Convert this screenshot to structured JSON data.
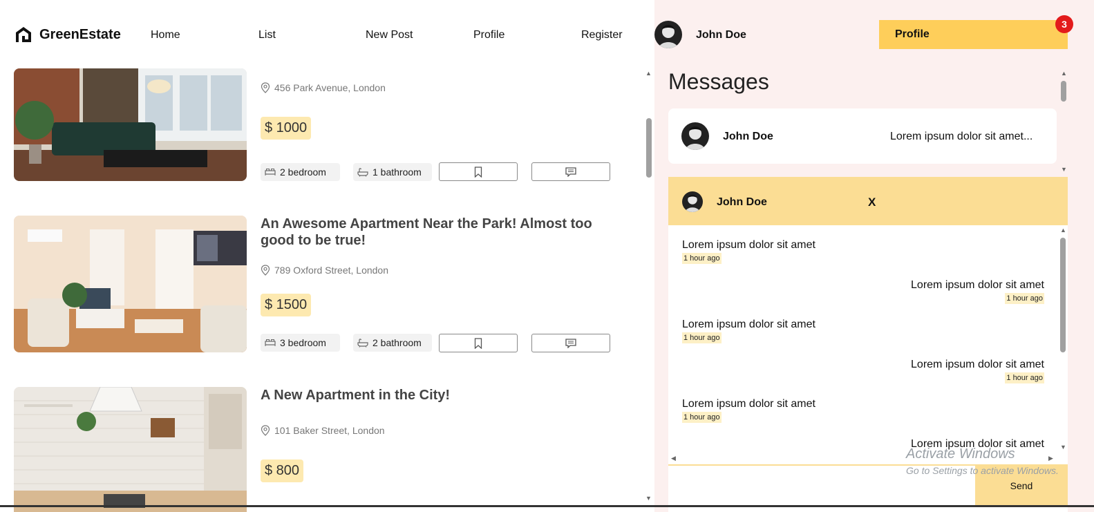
{
  "brand": {
    "name": "GreenEstate"
  },
  "nav": {
    "links": [
      "Home",
      "List",
      "New Post",
      "Profile",
      "Register"
    ]
  },
  "user": {
    "name": "John Doe",
    "profile_label": "Profile",
    "notification_count": "3"
  },
  "listings": [
    {
      "title": "",
      "address": "456 Park Avenue, London",
      "price": "$ 1000",
      "bedrooms": "2 bedroom",
      "bathrooms": "1 bathroom"
    },
    {
      "title": "An Awesome Apartment Near the Park! Almost too good to be true!",
      "address": "789 Oxford Street, London",
      "price": "$ 1500",
      "bedrooms": "3 bedroom",
      "bathrooms": "2 bathroom"
    },
    {
      "title": "A New Apartment in the City!",
      "address": "101 Baker Street, London",
      "price": "$ 800"
    }
  ],
  "messages": {
    "title": "Messages",
    "conversations": [
      {
        "name": "John Doe",
        "preview": "Lorem ipsum dolor sit amet..."
      }
    ],
    "chat": {
      "name": "John Doe",
      "close_label": "X",
      "messages": [
        {
          "text": "Lorem ipsum dolor sit amet",
          "time": "1 hour ago",
          "side": "left"
        },
        {
          "text": "Lorem ipsum dolor sit amet",
          "time": "1 hour ago",
          "side": "right"
        },
        {
          "text": "Lorem ipsum dolor sit amet",
          "time": "1 hour ago",
          "side": "left"
        },
        {
          "text": "Lorem ipsum dolor sit amet",
          "time": "1 hour ago",
          "side": "right"
        },
        {
          "text": "Lorem ipsum dolor sit amet",
          "time": "1 hour ago",
          "side": "left"
        },
        {
          "text": "Lorem ipsum dolor sit amet",
          "time": "",
          "side": "right"
        }
      ],
      "send_label": "Send"
    }
  },
  "watermark": {
    "line1": "Activate Windows",
    "line2": "Go to Settings to activate Windows."
  }
}
